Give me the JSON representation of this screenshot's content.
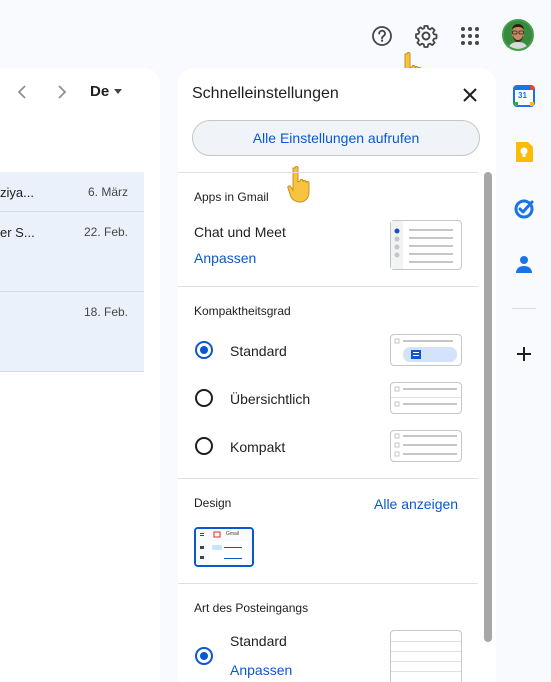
{
  "header": {
    "icons": [
      "help-icon",
      "settings-gear-icon",
      "apps-grid-icon",
      "avatar"
    ]
  },
  "mail": {
    "language": "De",
    "rows": [
      {
        "snippet": "ziya...",
        "date": "6. März"
      },
      {
        "snippet": "er S...",
        "date": "22. Feb."
      },
      {
        "snippet": "",
        "date": "18. Feb."
      }
    ]
  },
  "quick_settings": {
    "title": "Schnelleinstellungen",
    "all_settings_button": "Alle Einstellungen aufrufen",
    "apps_section": {
      "label": "Apps in Gmail",
      "item": "Chat und Meet",
      "customize_link": "Anpassen"
    },
    "density": {
      "label": "Kompaktheitsgrad",
      "options": [
        {
          "label": "Standard",
          "selected": true
        },
        {
          "label": "Übersichtlich",
          "selected": false
        },
        {
          "label": "Kompakt",
          "selected": false
        }
      ]
    },
    "design": {
      "label": "Design",
      "show_all_link": "Alle anzeigen",
      "thumb_text": "Gmail"
    },
    "inbox_type": {
      "label": "Art des Posteingangs",
      "option": "Standard",
      "customize_link": "Anpassen",
      "selected": true
    }
  },
  "side_rail": {
    "items": [
      "calendar-icon",
      "keep-icon",
      "tasks-icon",
      "contacts-icon",
      "add-icon"
    ],
    "calendar_day": "31"
  },
  "colors": {
    "accent": "#0b57d0",
    "selected_row": "#eaf1fb",
    "panel_bg": "#ffffff",
    "page_bg": "#f8fafd"
  }
}
